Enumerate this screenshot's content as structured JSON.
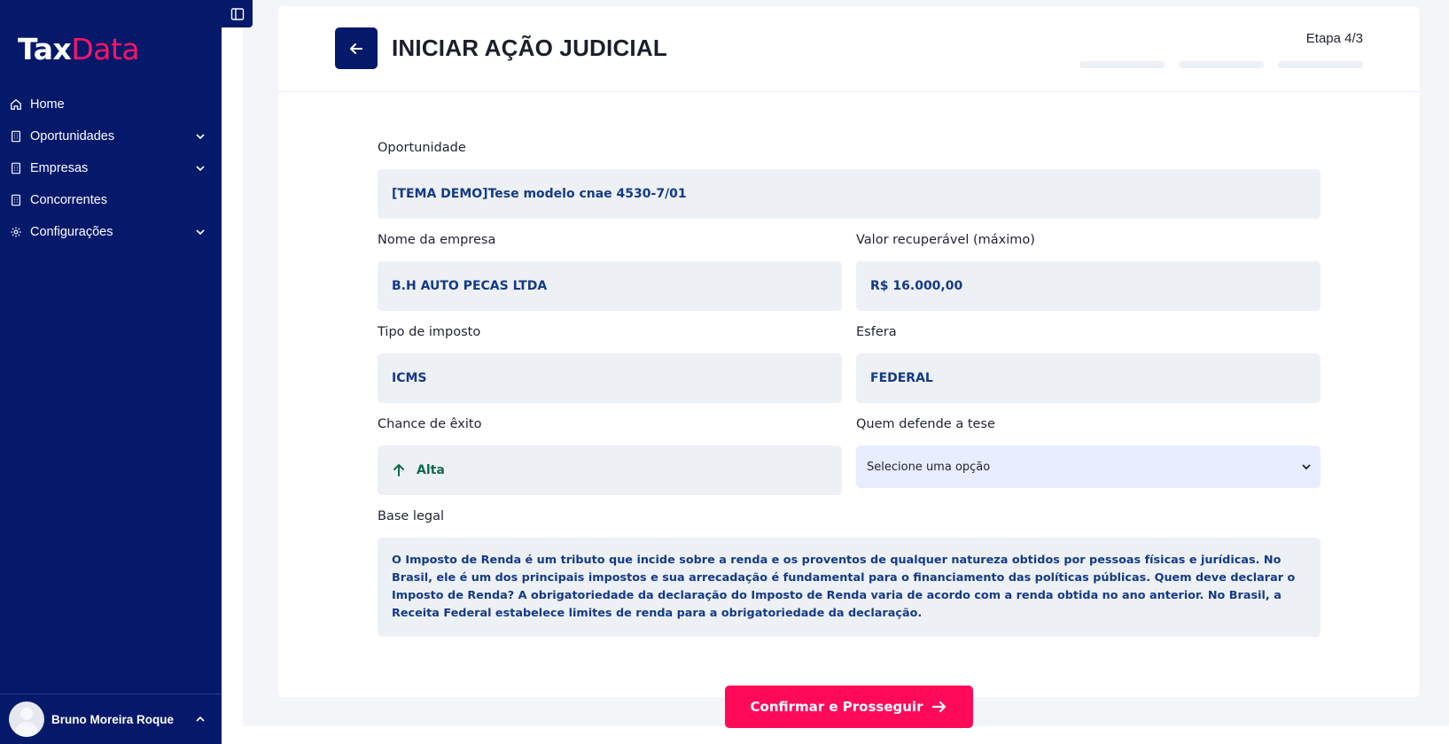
{
  "brand": {
    "part1": "Tax",
    "part2": "Data"
  },
  "sidebar": {
    "items": [
      {
        "label": "Home",
        "icon": "home-icon",
        "has_submenu": false
      },
      {
        "label": "Oportunidades",
        "icon": "building-icon",
        "has_submenu": true
      },
      {
        "label": "Empresas",
        "icon": "building-icon",
        "has_submenu": true
      },
      {
        "label": "Concorrentes",
        "icon": "building-icon",
        "has_submenu": false
      },
      {
        "label": "Configurações",
        "icon": "gear-icon",
        "has_submenu": true
      }
    ],
    "user": {
      "name": "Bruno Moreira Roque"
    }
  },
  "header": {
    "title": "INICIAR AÇÃO JUDICIAL",
    "step": "Etapa 4/3"
  },
  "form": {
    "oportunidade": {
      "label": "Oportunidade",
      "value": "[TEMA DEMO]Tese modelo cnae 4530-7/01"
    },
    "empresa": {
      "label": "Nome da empresa",
      "value": "B.H AUTO PECAS LTDA"
    },
    "valor": {
      "label": "Valor recuperável (máximo)",
      "value": "R$ 16.000,00"
    },
    "imposto": {
      "label": "Tipo de imposto",
      "value": "ICMS"
    },
    "esfera": {
      "label": "Esfera",
      "value": "FEDERAL"
    },
    "chance": {
      "label": "Chance de êxito",
      "value": "Alta"
    },
    "defensor": {
      "label": "Quem defende a tese",
      "selected": "Selecione uma opção"
    },
    "base_legal": {
      "label": "Base legal",
      "value": "O Imposto de Renda é um tributo que incide sobre a renda e os proventos de qualquer natureza obtidos por pessoas físicas e jurídicas. No Brasil, ele é um dos principais impostos e sua arrecadação é fundamental para o financiamento das políticas públicas. Quem deve declarar o Imposto de Renda? A obrigatoriedade da declaração do Imposto de Renda varia de acordo com a renda obtida no ano anterior. No Brasil, a Receita Federal estabelece limites de renda para a obrigatoriedade da declaração."
    }
  },
  "actions": {
    "confirm_label": "Confirmar e Prosseguir"
  },
  "colors": {
    "sidebar": "#05196b",
    "accent": "#ff0a5a",
    "field_bg": "#edf1f6",
    "value_text": "#143a86",
    "success": "#0e6b47"
  }
}
